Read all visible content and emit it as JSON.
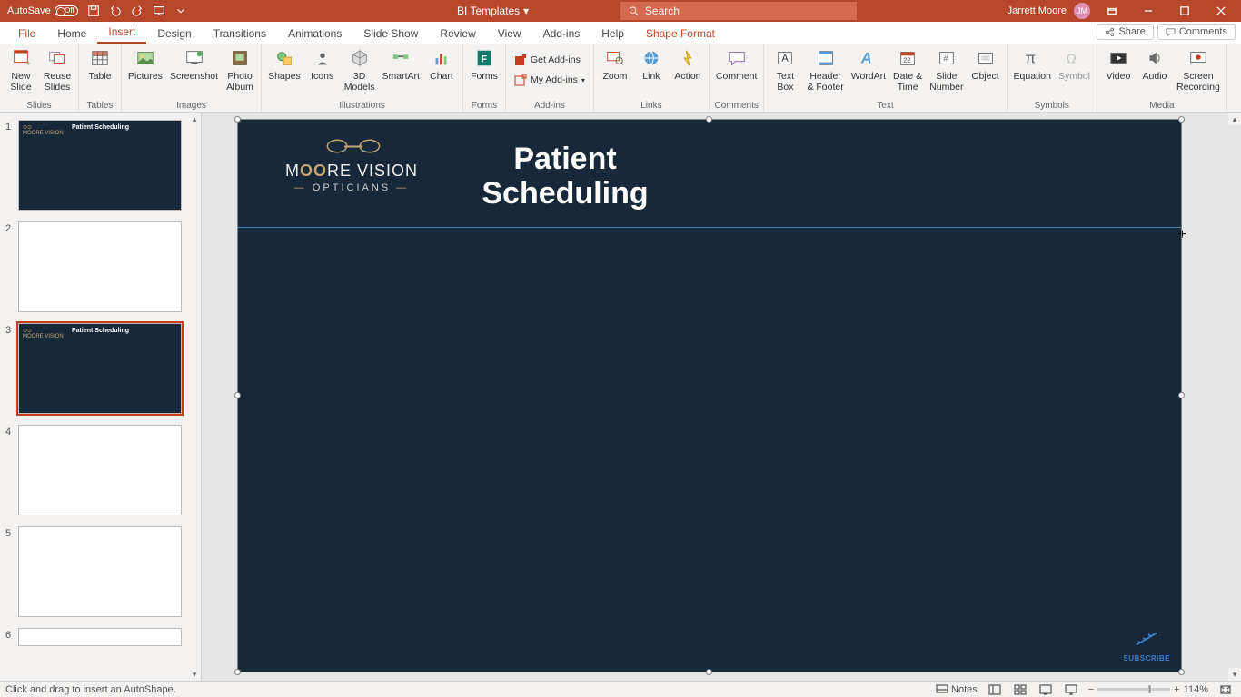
{
  "titlebar": {
    "autosave_label": "AutoSave",
    "autosave_state": "Off",
    "doc_title": "BI Templates",
    "search_placeholder": "Search",
    "user_name": "Jarrett Moore",
    "user_initials": "JM"
  },
  "tabs": {
    "items": [
      "File",
      "Home",
      "Insert",
      "Design",
      "Transitions",
      "Animations",
      "Slide Show",
      "Review",
      "View",
      "Add-ins",
      "Help",
      "Shape Format"
    ],
    "active": "Insert",
    "share": "Share",
    "comments": "Comments"
  },
  "ribbon": {
    "groups": {
      "slides": {
        "label": "Slides",
        "new_slide": "New\nSlide",
        "reuse_slides": "Reuse\nSlides"
      },
      "tables": {
        "label": "Tables",
        "table": "Table"
      },
      "images": {
        "label": "Images",
        "pictures": "Pictures",
        "screenshot": "Screenshot",
        "photo_album": "Photo\nAlbum"
      },
      "illustrations": {
        "label": "Illustrations",
        "shapes": "Shapes",
        "icons": "Icons",
        "models": "3D\nModels",
        "smartart": "SmartArt",
        "chart": "Chart"
      },
      "forms": {
        "label": "Forms",
        "forms": "Forms"
      },
      "addins": {
        "label": "Add-ins",
        "get": "Get Add-ins",
        "my": "My Add-ins"
      },
      "links": {
        "label": "Links",
        "zoom": "Zoom",
        "link": "Link",
        "action": "Action"
      },
      "comments": {
        "label": "Comments",
        "comment": "Comment"
      },
      "text": {
        "label": "Text",
        "textbox": "Text\nBox",
        "header": "Header\n& Footer",
        "wordart": "WordArt",
        "datetime": "Date &\nTime",
        "slidenum": "Slide\nNumber",
        "object": "Object"
      },
      "symbols": {
        "label": "Symbols",
        "equation": "Equation",
        "symbol": "Symbol"
      },
      "media": {
        "label": "Media",
        "video": "Video",
        "audio": "Audio",
        "screenrec": "Screen\nRecording"
      }
    }
  },
  "thumbnails": {
    "slides": [
      {
        "num": "1",
        "dark": true,
        "selected": false,
        "title": "Patient\nScheduling"
      },
      {
        "num": "2",
        "dark": false,
        "selected": false
      },
      {
        "num": "3",
        "dark": true,
        "selected": true,
        "title": "Patient\nScheduling"
      },
      {
        "num": "4",
        "dark": false,
        "selected": false
      },
      {
        "num": "5",
        "dark": false,
        "selected": false
      },
      {
        "num": "6",
        "dark": false,
        "selected": false
      }
    ]
  },
  "slide": {
    "logo": {
      "brand_pre": "M",
      "brand_mid": "OO",
      "brand_post": "RE VISION",
      "sub": "OPTICIANS"
    },
    "title": "Patient Scheduling",
    "title_line1": "Patient",
    "title_line2": "Scheduling",
    "subscribe": "SUBSCRIBE"
  },
  "status": {
    "left": "Click and drag to insert an AutoShape.",
    "notes": "Notes",
    "zoom_pct": "114%"
  }
}
